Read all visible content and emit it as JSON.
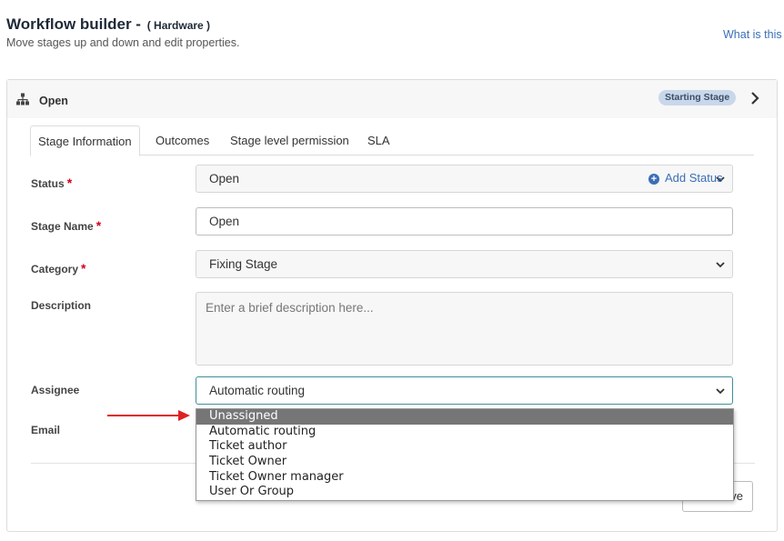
{
  "header": {
    "title": "Workflow builder -",
    "context": "( Hardware )",
    "subtitle": "Move stages up and down and edit properties.",
    "help_link": "What is this ?"
  },
  "stage": {
    "name": "Open",
    "badge": "Starting Stage"
  },
  "tabs": [
    {
      "label": "Stage Information",
      "active": true
    },
    {
      "label": "Outcomes",
      "active": false
    },
    {
      "label": "Stage level permission",
      "active": false
    },
    {
      "label": "SLA",
      "active": false
    }
  ],
  "form": {
    "status_label": "Status",
    "status_value": "Open",
    "add_status_label": "Add Status",
    "stage_name_label": "Stage Name",
    "stage_name_value": "Open",
    "category_label": "Category",
    "category_value": "Fixing Stage",
    "description_label": "Description",
    "description_placeholder": "Enter a brief description here...",
    "assignee_label": "Assignee",
    "assignee_value": "Automatic routing",
    "email_label": "Email",
    "required_mark": "*"
  },
  "assignee_options": [
    {
      "label": "Unassigned",
      "highlighted": true
    },
    {
      "label": "Automatic routing",
      "highlighted": false
    },
    {
      "label": "Ticket author",
      "highlighted": false
    },
    {
      "label": "Ticket Owner",
      "highlighted": false
    },
    {
      "label": "Ticket Owner manager",
      "highlighted": false
    },
    {
      "label": "User Or Group",
      "highlighted": false
    }
  ],
  "footer": {
    "save_label": "Save"
  },
  "colors": {
    "accent": "#3b6fb6",
    "required": "#d0021b",
    "annotation_arrow": "#e02020",
    "badge_bg": "#c9d7ea",
    "focus_border": "#3f8f99",
    "option_highlight": "#767676"
  },
  "icons": {
    "stage": "sitemap-icon",
    "expand": "chevron-right-icon",
    "select": "chevron-down-icon",
    "add": "plus-circle-icon",
    "annotation": "red-arrow-icon"
  }
}
